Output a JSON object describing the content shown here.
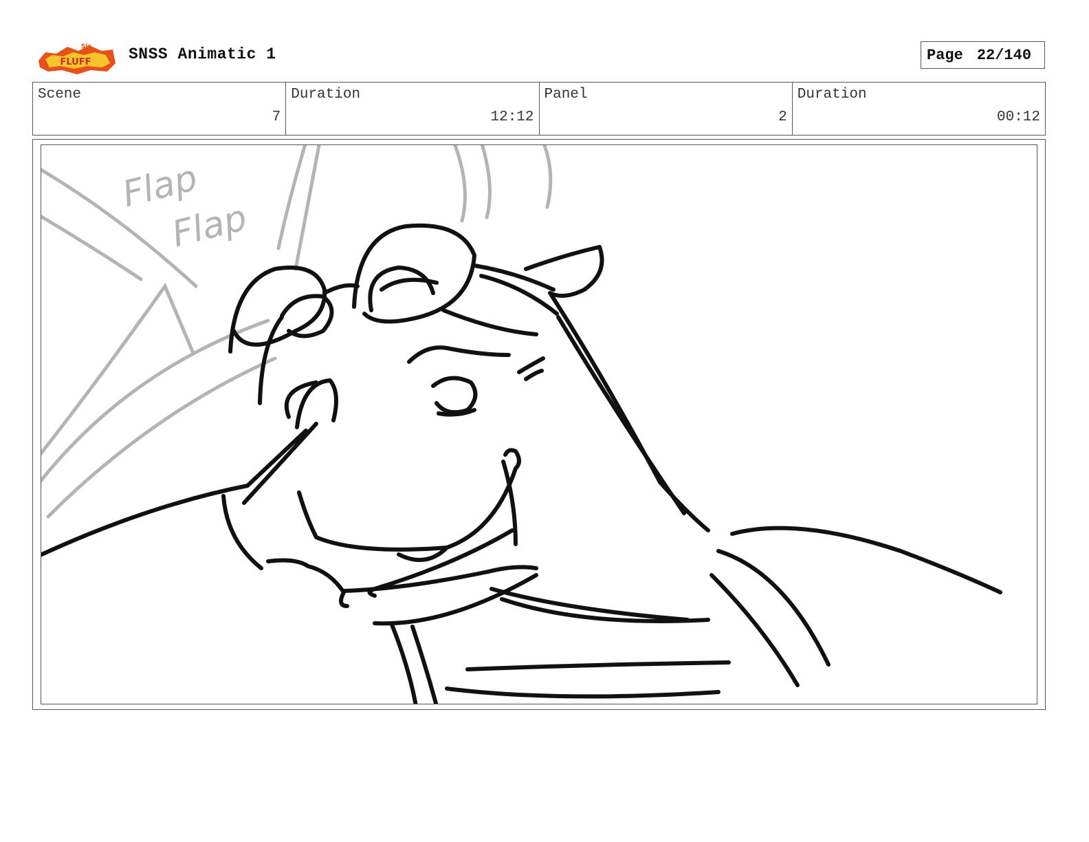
{
  "header": {
    "logo_text": "Sir Fluff-So-Stuff",
    "title": "SNSS Animatic 1",
    "page_label": "Page",
    "page_value": "22/140"
  },
  "info": {
    "scene_label": "Scene",
    "scene_value": "7",
    "duration_label": "Duration",
    "duration_value": "12:12",
    "panel_label": "Panel",
    "panel_value": "2",
    "panel_duration_label": "Duration",
    "panel_duration_value": "00:12"
  },
  "panel": {
    "sfx_1": "Flap",
    "sfx_2": "Flap"
  },
  "colors": {
    "sketch_line": "#111111",
    "rough_line": "#b4b4b4",
    "border": "#555555",
    "logo_orange": "#e8501a",
    "logo_yellow": "#f7c52b"
  }
}
